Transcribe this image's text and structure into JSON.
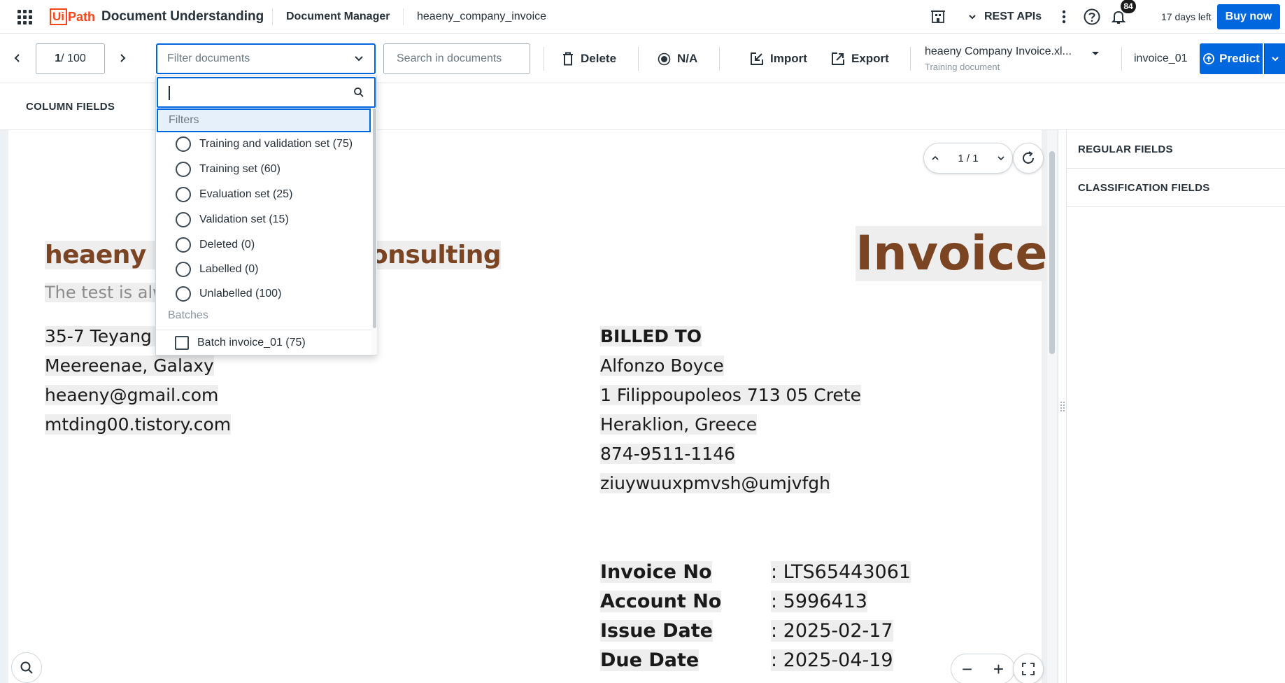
{
  "topbar": {
    "logo_ui": "Ui",
    "logo_path": "Path",
    "app_name": "Document Understanding",
    "breadcrumb_1": "Document Manager",
    "breadcrumb_2": "heaeny_company_invoice",
    "rest_apis": "REST APIs",
    "notification_count": "84",
    "days_left": "17 days left",
    "buy_now": "Buy now"
  },
  "toolbar": {
    "page_current": "1",
    "page_total": "/ 100",
    "filter_placeholder": "Filter documents",
    "search_placeholder": "Search in documents",
    "delete_label": "Delete",
    "na_label": "N/A",
    "import_label": "Import",
    "export_label": "Export",
    "document_name": "heaeny Company Invoice.xl...",
    "document_type": "Training document",
    "batch_name": "invoice_01",
    "predict_label": "Predict"
  },
  "left_panel": {
    "column_fields": "COLUMN FIELDS"
  },
  "right_panel": {
    "regular_fields": "REGULAR FIELDS",
    "classification_fields": "CLASSIFICATION FIELDS"
  },
  "dropdown": {
    "search_value": "",
    "filters_header": "Filters",
    "filters": [
      {
        "label": "Training and validation set (75)"
      },
      {
        "label": "Training set (60)"
      },
      {
        "label": "Evaluation set (25)"
      },
      {
        "label": "Validation set (15)"
      },
      {
        "label": "Deleted (0)"
      },
      {
        "label": "Labelled (0)"
      },
      {
        "label": "Unlabelled (100)"
      }
    ],
    "batches_header": "Batches",
    "batches": [
      {
        "label": "Batch invoice_01 (75)"
      }
    ]
  },
  "document": {
    "page_indicator": "1  /  1",
    "company": "heaeny Co",
    "company_end": "onsulting",
    "tagline": "The test is alwa",
    "title": "Invoice",
    "address_lines": [
      "35-7 Teyang s",
      "Meereenae, Galaxy",
      "heaeny@gmail.com",
      "mtding00.tistory.com"
    ],
    "billed_to_header": "BILLED TO",
    "billed_to_lines": [
      "Alfonzo Boyce",
      "1 Filippoupoleos 713 05 Crete",
      "Heraklion, Greece",
      "874-9511-1146",
      "ziuywuuxpmvsh@umjvfgh"
    ],
    "invoice_fields": [
      {
        "label": "Invoice No",
        "value": ": LTS65443061"
      },
      {
        "label": "Account No",
        "value": ": 5996413"
      },
      {
        "label": "Issue Date",
        "value": ": 2025-02-17"
      },
      {
        "label": "Due Date",
        "value": ": 2025-04-19"
      }
    ]
  },
  "colors": {
    "brand": "#fa4616",
    "accent": "#0067df",
    "invoice_brown": "#7b4423"
  }
}
